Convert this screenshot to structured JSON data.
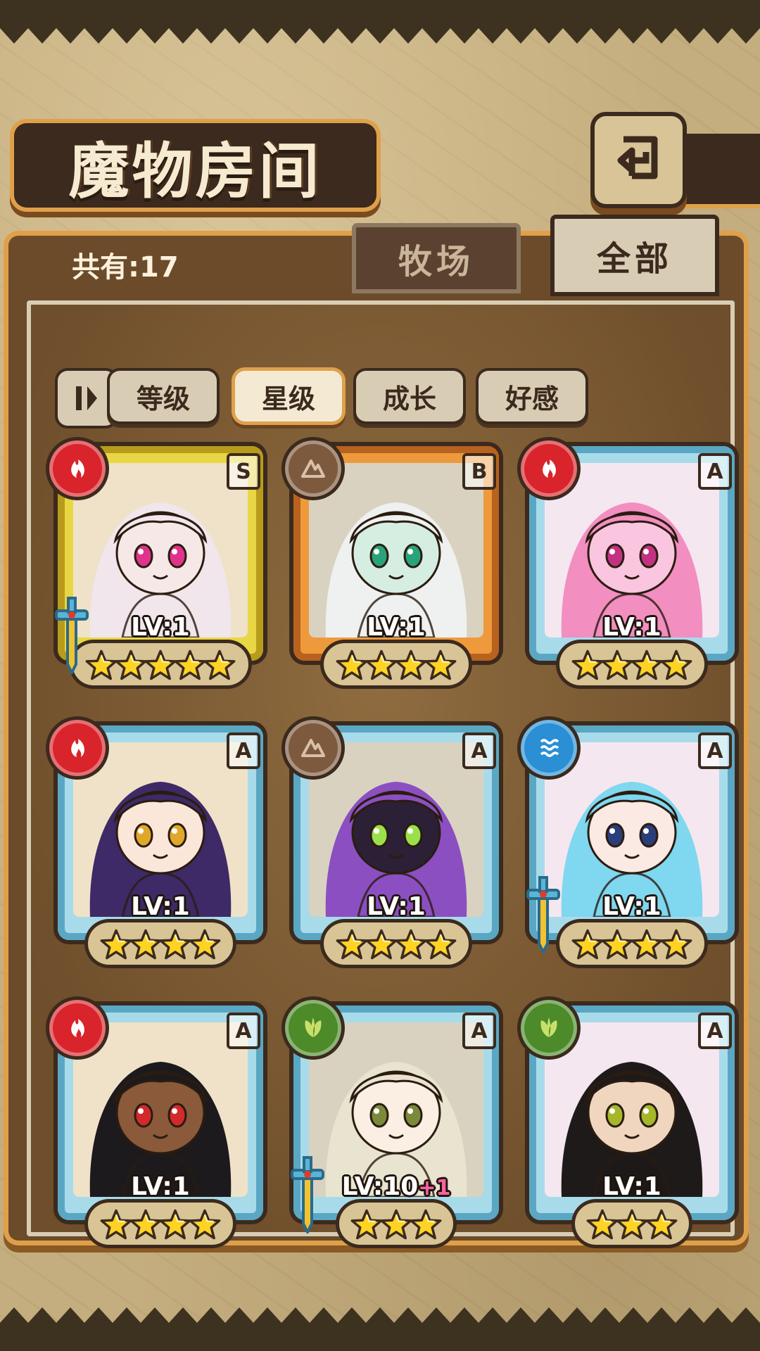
{
  "header": {
    "title": "魔物房间",
    "back_icon": "back-arrow-icon"
  },
  "count": {
    "text": "共有:17"
  },
  "tabs": [
    {
      "label": "牧场",
      "active": false
    },
    {
      "label": "全部",
      "active": true
    }
  ],
  "filters": [
    {
      "label": "等级",
      "active": false
    },
    {
      "label": "星级",
      "active": true
    },
    {
      "label": "成长",
      "active": false
    },
    {
      "label": "好感",
      "active": false
    }
  ],
  "colors": {
    "accent": "#e0a04a",
    "panel": "#6b4b2a",
    "ink": "#3b2a1d"
  },
  "monsters": [
    {
      "element": "fire",
      "rank": "S",
      "level": "LV:1",
      "bonus": "",
      "stars": 5,
      "frame": "gold",
      "weapon": true,
      "hair": "#f0e6ec",
      "skin": "#f7e8e8",
      "eye": "#e0338c"
    },
    {
      "element": "earth",
      "rank": "B",
      "level": "LV:1",
      "bonus": "",
      "stars": 4,
      "frame": "bronze",
      "weapon": false,
      "hair": "#eef1f0",
      "skin": "#d6ede2",
      "eye": "#2aa37a"
    },
    {
      "element": "fire",
      "rank": "A",
      "level": "LV:1",
      "bonus": "",
      "stars": 4,
      "frame": "blue",
      "weapon": false,
      "hair": "#f28ec0",
      "skin": "#f9c5df",
      "eye": "#c23282"
    },
    {
      "element": "fire",
      "rank": "A",
      "level": "LV:1",
      "bonus": "",
      "stars": 4,
      "frame": "blue",
      "weapon": false,
      "hair": "#3e2a66",
      "skin": "#fbe7da",
      "eye": "#e0a82a"
    },
    {
      "element": "earth",
      "rank": "A",
      "level": "LV:1",
      "bonus": "",
      "stars": 4,
      "frame": "blue",
      "weapon": false,
      "hair": "#8b4fc2",
      "skin": "#2c2036",
      "eye": "#9be04a"
    },
    {
      "element": "water",
      "rank": "A",
      "level": "LV:1",
      "bonus": "",
      "stars": 4,
      "frame": "blue",
      "weapon": true,
      "hair": "#7fd7f0",
      "skin": "#fbe9e3",
      "eye": "#2a3e7a"
    },
    {
      "element": "fire",
      "rank": "A",
      "level": "LV:1",
      "bonus": "",
      "stars": 4,
      "frame": "blue",
      "weapon": false,
      "hair": "#1d1a1d",
      "skin": "#8a5a3a",
      "eye": "#d22a2a"
    },
    {
      "element": "wood",
      "rank": "A",
      "level": "LV:10",
      "bonus": "+1",
      "stars": 3,
      "frame": "blue",
      "weapon": true,
      "hair": "#e8e4cf",
      "skin": "#fbeee2",
      "eye": "#7a8a3a"
    },
    {
      "element": "wood",
      "rank": "A",
      "level": "LV:1",
      "bonus": "",
      "stars": 3,
      "frame": "blue",
      "weapon": false,
      "hair": "#1f1a1a",
      "skin": "#f0d6bf",
      "eye": "#a6b82a"
    }
  ]
}
